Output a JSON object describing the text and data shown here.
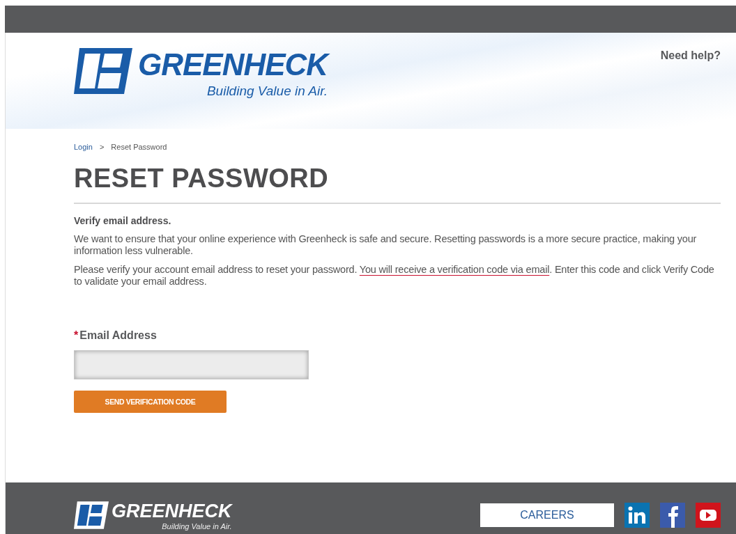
{
  "header": {
    "logo_name": "GREENHECK",
    "logo_tagline": "Building Value in Air.",
    "help_link": "Need help?"
  },
  "breadcrumb": [
    {
      "label": "Login",
      "kind": "link"
    },
    {
      "label": ">",
      "kind": "separator"
    },
    {
      "label": "Reset Password",
      "kind": "current"
    }
  ],
  "page_title": "RESET PASSWORD",
  "section_title": "Verify email address.",
  "paragraphs": [
    [
      {
        "text": "We want to ensure that your online experience with Greenheck is safe and secure. Resetting passwords is a more secure practice, making your information less vulnerable.",
        "underlined": false
      }
    ],
    [
      {
        "text": "Please verify your account email address to reset your password. ",
        "underlined": false
      },
      {
        "text": "You will receive a verification code via email",
        "underlined": true
      },
      {
        "text": ". Enter this code and click Verify Code to validate your email address.",
        "underlined": false
      }
    ]
  ],
  "email_field": {
    "required_mark": "*",
    "label": "Email Address"
  },
  "send_button": "SEND VERIFICATION CODE",
  "footer": {
    "logo_name": "GREENHECK",
    "logo_tagline": "Building Value in Air.",
    "careers_link": "CAREERS",
    "social": [
      {
        "kind": "linkedin",
        "color": "#0a73b1"
      },
      {
        "kind": "facebook",
        "color": "#3b5bab"
      },
      {
        "kind": "youtube",
        "color": "#d0141c"
      }
    ]
  }
}
